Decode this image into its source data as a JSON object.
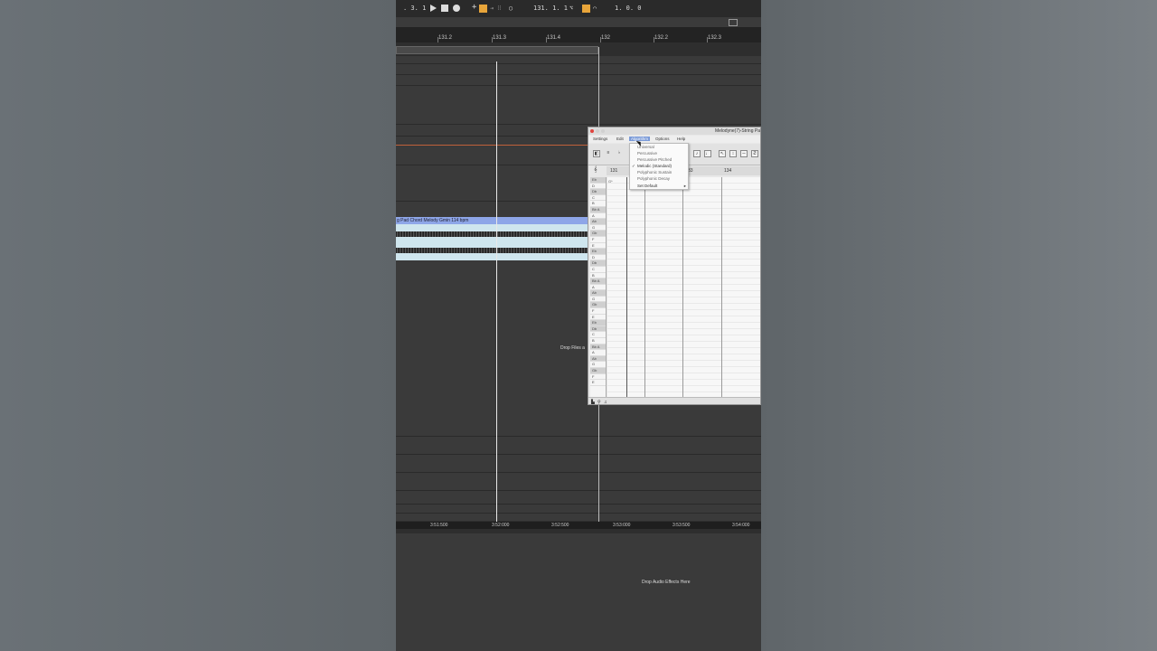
{
  "transport": {
    "position_left": ". 3. 1",
    "position_main": "131. 1. 1",
    "position_end": "1. 0. 0"
  },
  "ruler": {
    "ticks": [
      "131.2",
      "131.3",
      "131.4",
      "132",
      "132.2",
      "132.3"
    ]
  },
  "clip": {
    "title": "g Pad Chord Melody Gmin 114 bpm"
  },
  "time_ruler": {
    "ticks": [
      "3:51:500",
      "3:52:000",
      "3:52:500",
      "3:53:000",
      "3:53:500",
      "3:54:000"
    ]
  },
  "drop_files_label": "Drop Files a",
  "drop_fx_label": "Drop Audio Effects Here",
  "melodyne": {
    "title": "Melodyne(7)-String Pa",
    "menu": [
      "Settings",
      "Edit",
      "Algorithm",
      "Options",
      "Help"
    ],
    "timeline": [
      "131",
      "33",
      "134"
    ],
    "scale_label": "G*",
    "keys": [
      "Eb",
      "D",
      "Db",
      "C",
      "B",
      "Bb A",
      "A",
      "Ab",
      "G",
      "Gb",
      "F",
      "E",
      "Eb",
      "D",
      "Db",
      "C",
      "B",
      "Bb A",
      "A",
      "Ab",
      "G",
      "Gb",
      "F",
      "E",
      "Eb",
      "Db",
      "C",
      "B",
      "Bb A",
      "A",
      "Ab",
      "G",
      "Gb",
      "F",
      "E"
    ],
    "algorithm_menu": {
      "items": [
        "Universal",
        "Percussive",
        "Percussive Pitched",
        "Melodic (Standard)",
        "Polyphonic Sustain",
        "Polyphonic Decay"
      ],
      "checked": "Melodic (Standard)",
      "set_default": "Set Default"
    }
  },
  "colors": {
    "clip_header": "#8ea6e8",
    "clip_body": "#cfe6ee",
    "accent_orange": "#e8a53a",
    "menu_highlight": "#7a9ad8"
  }
}
